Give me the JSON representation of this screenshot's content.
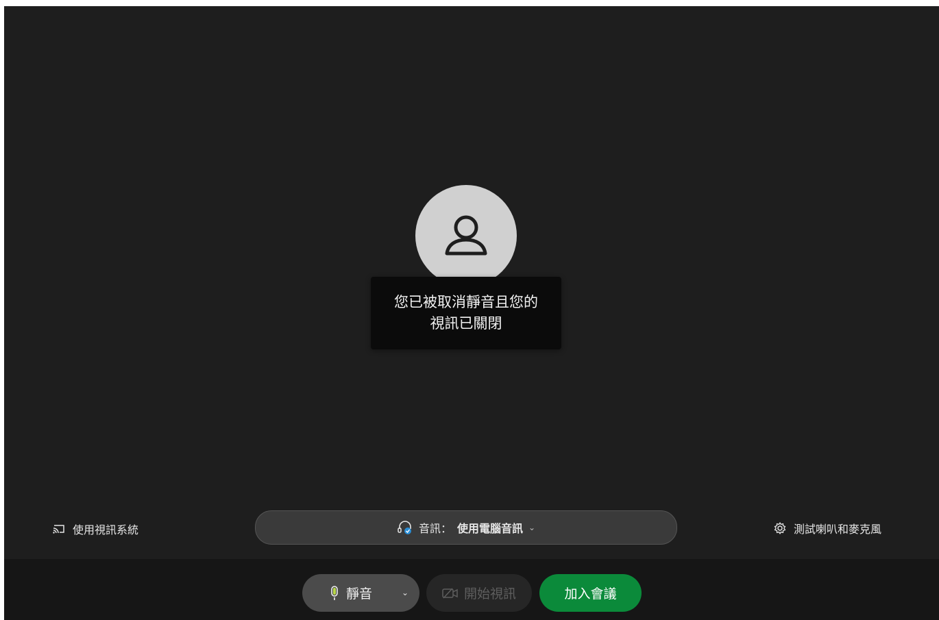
{
  "status": {
    "line1": "您已被取消靜音且您的",
    "line2": "視訊已關閉"
  },
  "footer": {
    "video_system_label": "使用視訊系統",
    "audio_label": "音訊：",
    "audio_value": "使用電腦音訊",
    "test_label": "測試喇叭和麥克風"
  },
  "controls": {
    "mute_label": "靜音",
    "video_label": "開始視訊",
    "join_label": "加入會議"
  },
  "icons": {
    "avatar": "person-icon",
    "video_system": "cast-icon",
    "audio": "headset-icon",
    "settings": "gear-icon",
    "mic": "microphone-icon",
    "camera": "camera-off-icon"
  },
  "colors": {
    "join_button": "#0b8a3a",
    "preview_bg": "#1e1e1e"
  }
}
